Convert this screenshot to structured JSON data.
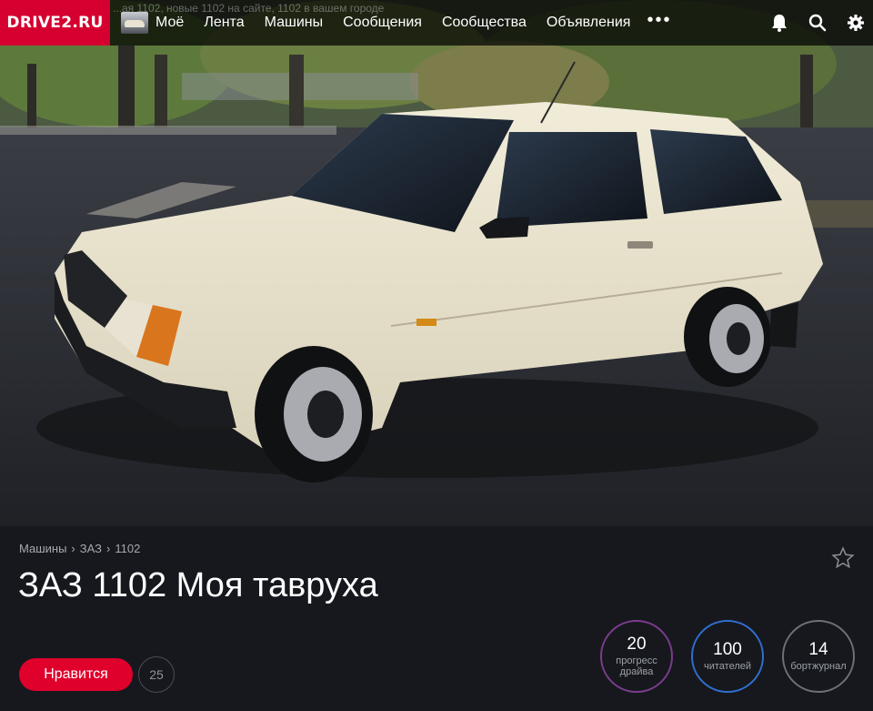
{
  "site": {
    "logo": "DRIVE2.RU",
    "ghost_text": "...ая 1102, новые 1102 на сайте, 1102 в вашем городе"
  },
  "nav": {
    "items": [
      "Моё",
      "Лента",
      "Машины",
      "Сообщения",
      "Сообщества",
      "Объявления"
    ],
    "more": "•••",
    "icons": [
      "bell-icon",
      "search-icon",
      "gear-icon"
    ]
  },
  "breadcrumb": [
    "Машины",
    "ЗАЗ",
    "1102"
  ],
  "breadcrumb_sep": "›",
  "title": "ЗАЗ 1102 Моя тавруха",
  "like": {
    "label": "Нравится",
    "count": "25"
  },
  "stats": [
    {
      "value": "20",
      "label": "прогресс драйва",
      "color": "#7b3c8c"
    },
    {
      "value": "100",
      "label": "читателей",
      "color": "#2f6fcf"
    },
    {
      "value": "14",
      "label": "бортжурнал",
      "color": "#6d7078"
    }
  ],
  "colors": {
    "accent": "#e0002c",
    "logo_bg": "#d5002f",
    "panel_bg": "#16181e"
  }
}
